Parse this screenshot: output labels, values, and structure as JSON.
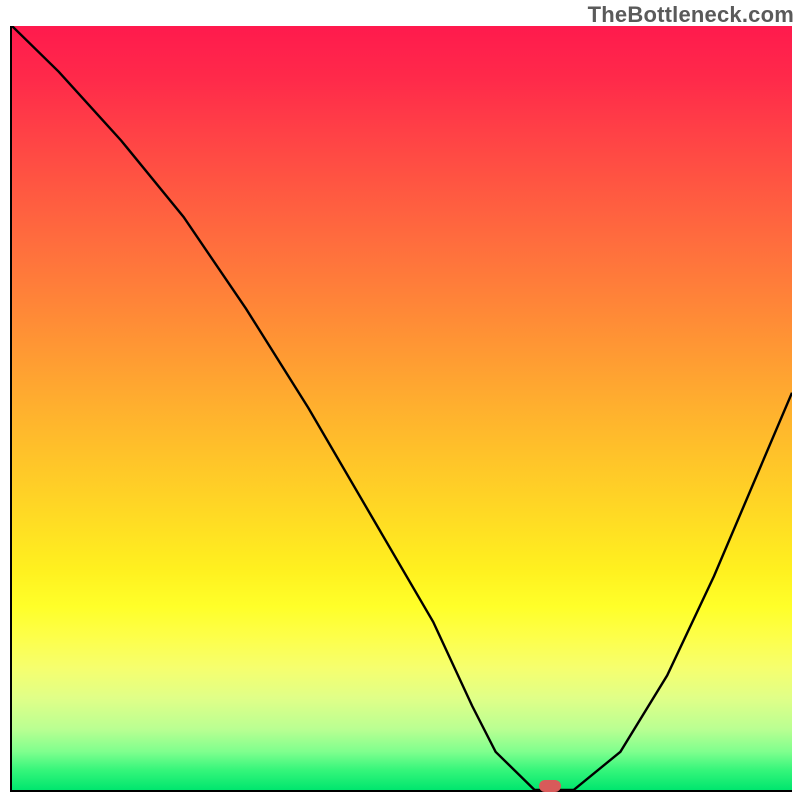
{
  "watermark": "TheBottleneck.com",
  "colors": {
    "border": "#000000",
    "curve": "#000000",
    "marker": "#d85a5a",
    "gradient_top": "#ff1a4d",
    "gradient_bottom": "#00e66e"
  },
  "chart_data": {
    "type": "line",
    "title": "",
    "xlabel": "",
    "ylabel": "",
    "xlim": [
      0,
      100
    ],
    "ylim": [
      0,
      100
    ],
    "x": [
      0,
      6,
      14,
      22,
      30,
      38,
      46,
      54,
      59,
      62,
      67,
      72,
      78,
      84,
      90,
      95,
      100
    ],
    "values": [
      100,
      94,
      85,
      75,
      63,
      50,
      36,
      22,
      11,
      5,
      0,
      0,
      5,
      15,
      28,
      40,
      52
    ],
    "minimum_marker": {
      "x": 69,
      "y": 0
    },
    "annotations": []
  }
}
